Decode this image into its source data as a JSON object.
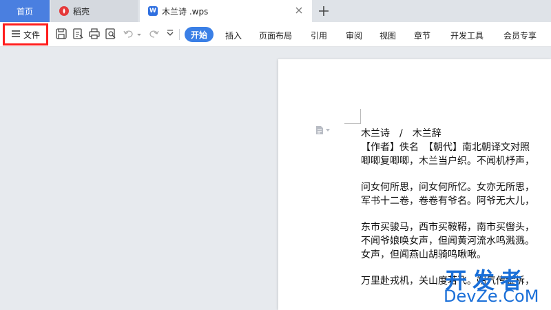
{
  "tabs": {
    "home": "首页",
    "daoke": "稻壳",
    "document": "木兰诗 .wps",
    "wps_icon_letter": "W"
  },
  "toolbar": {
    "file_label": "文件",
    "start_label": "开始",
    "menus": [
      "插入",
      "页面布局",
      "引用",
      "审阅",
      "视图",
      "章节",
      "开发工具",
      "会员专享"
    ]
  },
  "document": {
    "lines": [
      "木兰诗　/　木兰辞",
      "【作者】佚名　【朝代】南北朝译文对照",
      "唧唧复唧唧，木兰当户织。不闻机杼声，",
      "",
      "问女何所思，问女何所忆。女亦无所思，",
      "军书十二卷，卷卷有爷名。阿爷无大儿，",
      "",
      "东市买骏马，西市买鞍鞯，南市买辔头，",
      "不闻爷娘唤女声，但闻黄河流水鸣溅溅。",
      "女声，但闻燕山胡骑鸣啾啾。",
      "",
      "万里赴戎机，关山度若飞。朔气传金柝，"
    ]
  },
  "watermark": {
    "top": "开发者",
    "bottom": "DevZe.CoM"
  },
  "colors": {
    "accent": "#3a7fe6",
    "highlight_box": "#ff1d1d",
    "home_tab": "#4a7fe0"
  },
  "icons": [
    "daoke-icon",
    "wps-doc-icon",
    "close-icon",
    "add-tab-icon",
    "hamburger-icon",
    "save-icon",
    "export-pdf-icon",
    "print-icon",
    "print-preview-icon",
    "undo-icon",
    "redo-icon",
    "more-icon",
    "paragraph-icon"
  ]
}
